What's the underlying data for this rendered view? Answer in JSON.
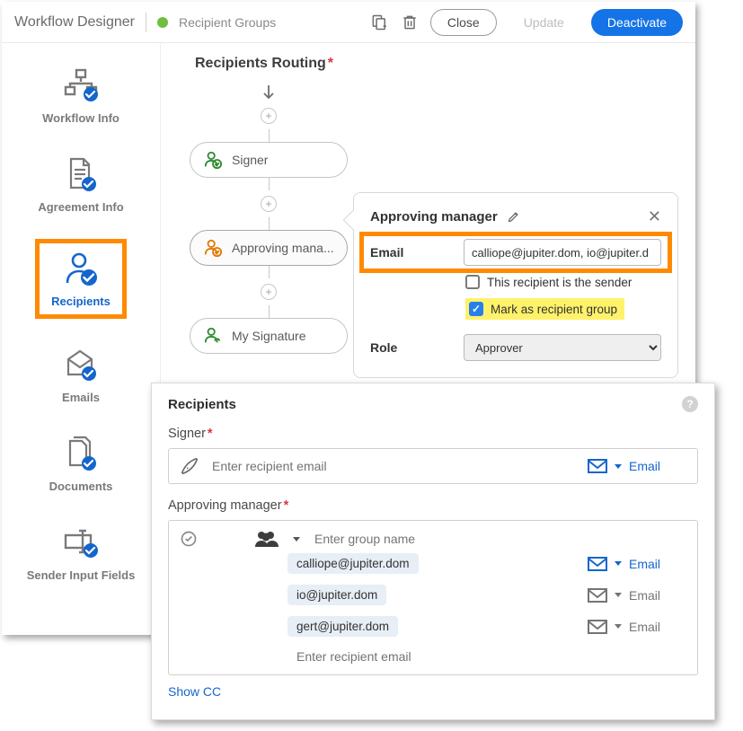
{
  "header": {
    "title": "Workflow Designer",
    "status": "Recipient Groups",
    "close": "Close",
    "update": "Update",
    "deactivate": "Deactivate"
  },
  "sidebar": [
    {
      "label": "Workflow Info"
    },
    {
      "label": "Agreement Info"
    },
    {
      "label": "Recipients"
    },
    {
      "label": "Emails"
    },
    {
      "label": "Documents"
    },
    {
      "label": "Sender Input Fields"
    }
  ],
  "canvas": {
    "title": "Recipients Routing",
    "steps": [
      {
        "label": "Signer"
      },
      {
        "label": "Approving mana..."
      },
      {
        "label": "My Signature"
      }
    ]
  },
  "editor": {
    "title": "Approving manager",
    "emailLabel": "Email",
    "emailValue": "calliope@jupiter.dom, io@jupiter.d",
    "isSender": "This recipient is the sender",
    "markGroup": "Mark as recipient group",
    "roleLabel": "Role",
    "roleValue": "Approver"
  },
  "recip": {
    "title": "Recipients",
    "signerLabel": "Signer",
    "signerPh": "Enter recipient email",
    "approverLabel": "Approving manager",
    "groupPh": "Enter group name",
    "emails": [
      "calliope@jupiter.dom",
      "io@jupiter.dom",
      "gert@jupiter.dom"
    ],
    "addPh": "Enter recipient email",
    "emailAction": "Email",
    "showcc": "Show CC"
  }
}
